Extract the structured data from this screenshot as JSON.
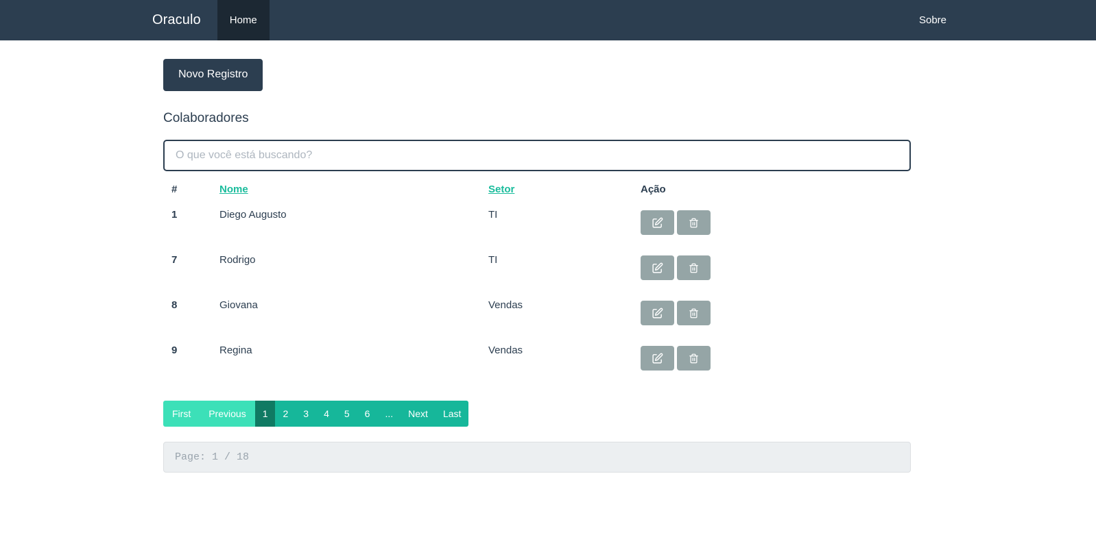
{
  "navbar": {
    "brand": "Oraculo",
    "items": [
      {
        "label": "Home",
        "active": true
      },
      {
        "label": "Sobre",
        "active": false
      }
    ],
    "bg_color": "#2c3e50",
    "active_bg_color": "#1c2833"
  },
  "toolbar": {
    "new_record_label": "Novo Registro"
  },
  "main": {
    "section_title": "Colaboradores"
  },
  "search": {
    "value": "",
    "placeholder": "O que você está buscando?"
  },
  "table": {
    "headers": {
      "id": "#",
      "name": "Nome",
      "sector": "Setor",
      "action": "Ação"
    },
    "rows": [
      {
        "id": "1",
        "name": "Diego Augusto",
        "sector": "TI"
      },
      {
        "id": "7",
        "name": "Rodrigo",
        "sector": "TI"
      },
      {
        "id": "8",
        "name": "Giovana",
        "sector": "Vendas"
      },
      {
        "id": "9",
        "name": "Regina",
        "sector": "Vendas"
      }
    ],
    "row_actions": {
      "edit_icon": "edit-icon",
      "delete_icon": "trash-icon"
    }
  },
  "pagination": {
    "first": "First",
    "previous": "Previous",
    "next": "Next",
    "last": "Last",
    "ellipsis": "...",
    "pages": [
      "1",
      "2",
      "3",
      "4",
      "5",
      "6"
    ],
    "active_page": "1",
    "colors": {
      "edge": "#3ce0b8",
      "page": "#16b79a",
      "active": "#107a63"
    }
  },
  "page_info": {
    "text": "Page: 1 / 18"
  },
  "colors": {
    "brand_dark": "#2c3e50",
    "accent_teal": "#1abc9c",
    "action_gray": "#95a5a6"
  }
}
